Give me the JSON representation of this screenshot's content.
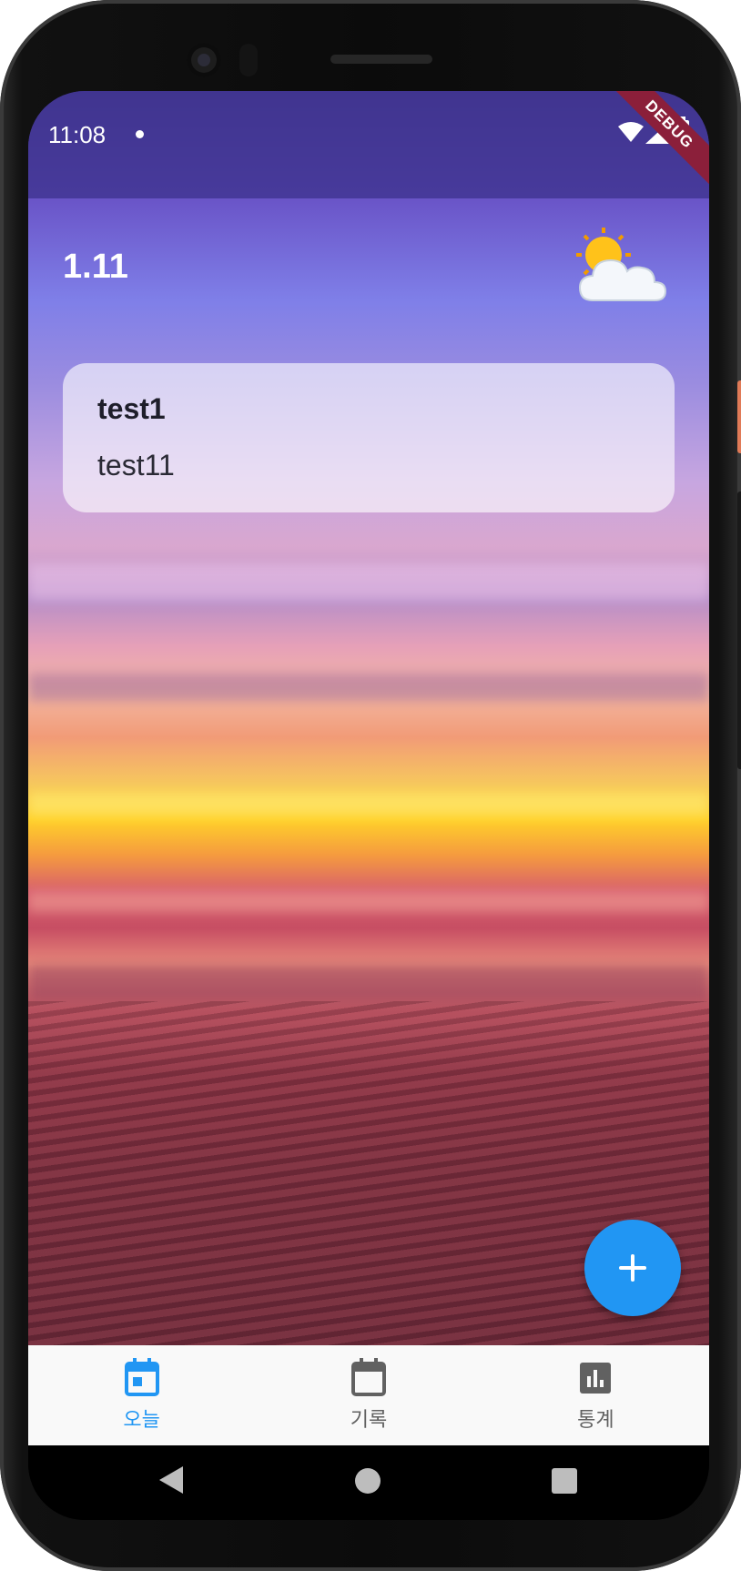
{
  "status_bar": {
    "time": "11:08",
    "wifi_icon": "wifi-icon",
    "signal_icon": "cell-signal-icon",
    "battery_icon": "battery-icon",
    "debug_ribbon": "DEBUG"
  },
  "header": {
    "date": "1.11",
    "weather_icon": "partly-sunny-icon"
  },
  "entries": [
    {
      "title": "test1",
      "body": "test11"
    }
  ],
  "fab": {
    "icon": "plus-icon",
    "label": "+"
  },
  "bottom_nav": {
    "items": [
      {
        "label": "오늘",
        "icon": "calendar-today-icon",
        "active": true
      },
      {
        "label": "기록",
        "icon": "calendar-icon",
        "active": false
      },
      {
        "label": "통계",
        "icon": "bar-chart-icon",
        "active": false
      }
    ]
  },
  "colors": {
    "accent": "#2196f3",
    "nav_inactive": "#616161",
    "debug_ribbon": "#8b1f3a"
  }
}
